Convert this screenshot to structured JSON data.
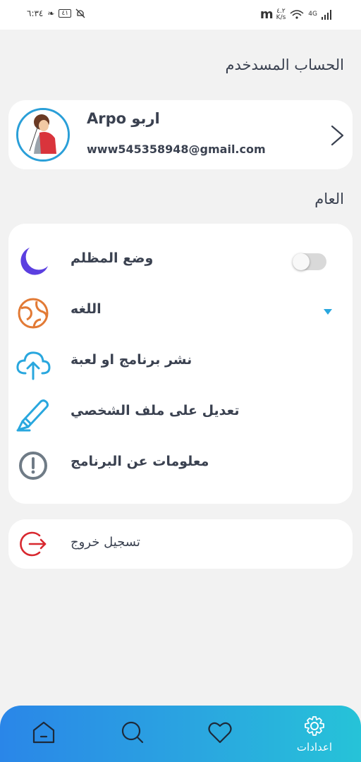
{
  "status_bar": {
    "time": "٦:٣٤",
    "battery": "٤١",
    "speed_value": "٤.٢",
    "speed_unit": "K/s",
    "network": "4G"
  },
  "account_section": {
    "title": "الحساب المسدخدم",
    "name": "Arpo اربو",
    "email": "www545358948@gmail.com"
  },
  "general_section": {
    "title": "العام",
    "items": [
      {
        "label": "وضع المظلم",
        "icon": "moon-icon",
        "control": "toggle",
        "toggle_on": false
      },
      {
        "label": "اللغه",
        "icon": "globe-icon",
        "control": "dropdown"
      },
      {
        "label": "نشر برنامج او لعبة",
        "icon": "cloud-upload-icon"
      },
      {
        "label": "تعديل على ملف الشخصي",
        "icon": "pencil-icon"
      },
      {
        "label": "معلومات عن البرنامج",
        "icon": "info-icon"
      }
    ]
  },
  "logout": {
    "label": "تسجيل خروج",
    "icon": "logout-icon"
  },
  "bottom_nav": {
    "items": [
      {
        "icon": "home-icon"
      },
      {
        "icon": "search-icon"
      },
      {
        "icon": "heart-icon"
      },
      {
        "icon": "gear-icon",
        "label": "اعدادات",
        "active": true
      }
    ]
  },
  "colors": {
    "accent": "#2a9fd8",
    "moon": "#5b3fe0",
    "globe": "#e27a35",
    "cloud": "#29a7de",
    "pencil": "#29a7de",
    "info": "#6f7b86",
    "logout": "#d8282f",
    "caret": "#29a7de"
  }
}
